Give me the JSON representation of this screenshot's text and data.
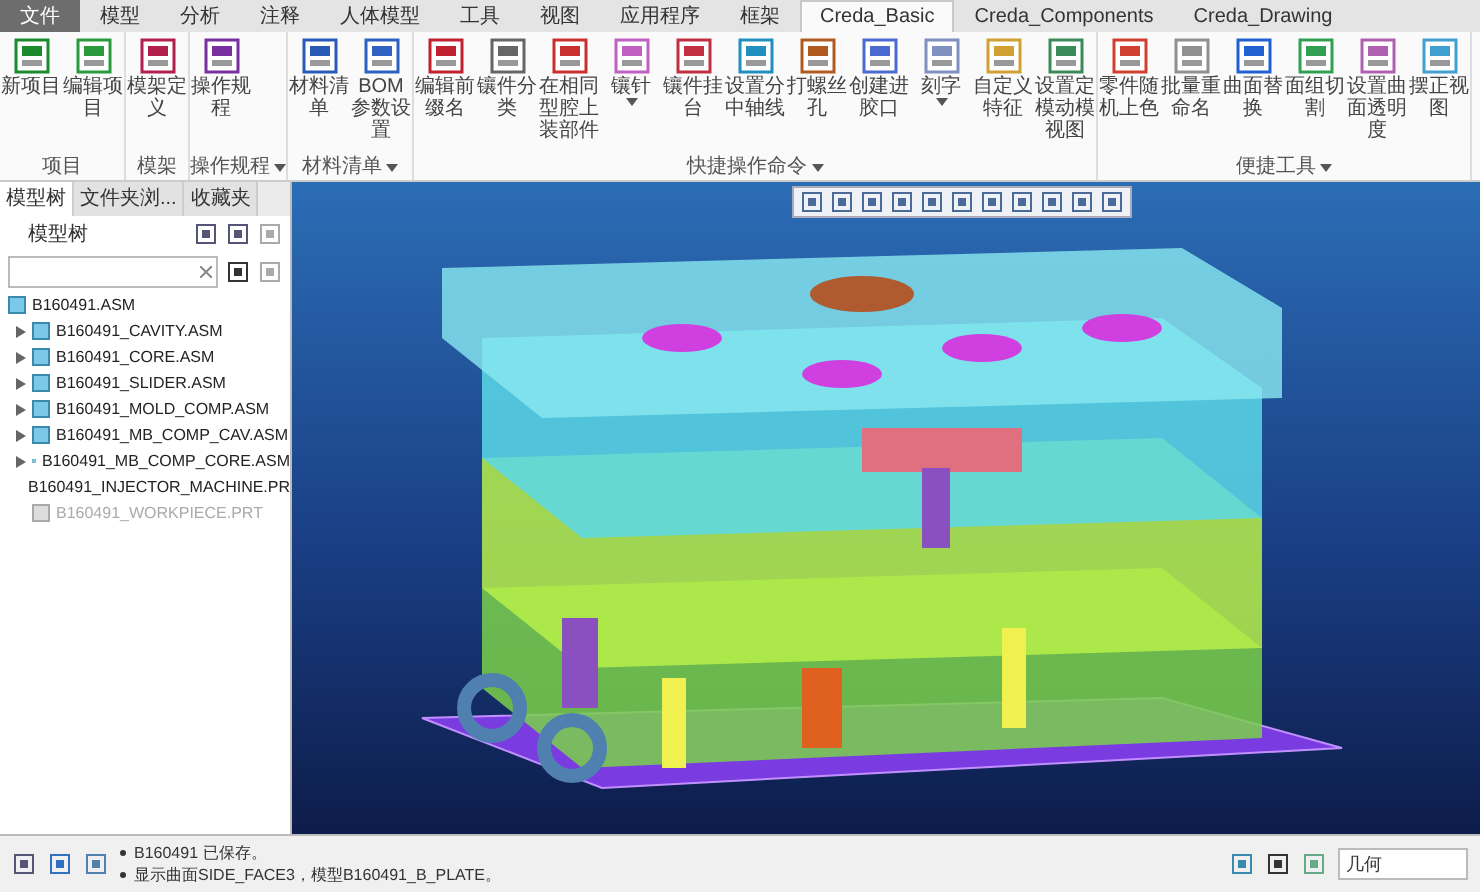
{
  "tabs": [
    {
      "label": "文件",
      "kind": "file",
      "selected": false
    },
    {
      "label": "模型",
      "kind": "tab",
      "selected": false
    },
    {
      "label": "分析",
      "kind": "tab",
      "selected": false
    },
    {
      "label": "注释",
      "kind": "tab",
      "selected": false
    },
    {
      "label": "人体模型",
      "kind": "tab",
      "selected": false
    },
    {
      "label": "工具",
      "kind": "tab",
      "selected": false
    },
    {
      "label": "视图",
      "kind": "tab",
      "selected": false
    },
    {
      "label": "应用程序",
      "kind": "tab",
      "selected": false
    },
    {
      "label": "框架",
      "kind": "tab",
      "selected": false
    },
    {
      "label": "Creda_Basic",
      "kind": "tab",
      "selected": true
    },
    {
      "label": "Creda_Components",
      "kind": "tab",
      "selected": false
    },
    {
      "label": "Creda_Drawing",
      "kind": "tab",
      "selected": false
    }
  ],
  "ribbon": [
    {
      "label": "项目",
      "has_menu": false,
      "tools": [
        {
          "label": "新项目",
          "has_menu": false
        },
        {
          "label": "编辑项目",
          "has_menu": false
        }
      ]
    },
    {
      "label": "模架",
      "has_menu": false,
      "tools": [
        {
          "label": "模架定义",
          "has_menu": false
        }
      ]
    },
    {
      "label": "操作规程",
      "has_menu": true,
      "tools": [
        {
          "label": "操作规程",
          "has_menu": false
        }
      ]
    },
    {
      "label": "材料清单",
      "has_menu": true,
      "tools": [
        {
          "label": "材料清单",
          "has_menu": false
        },
        {
          "label": "BOM参数设置",
          "has_menu": false
        }
      ]
    },
    {
      "label": "快捷操作命令",
      "has_menu": true,
      "tools": [
        {
          "label": "编辑前缀名",
          "has_menu": false
        },
        {
          "label": "镶件分类",
          "has_menu": false
        },
        {
          "label": "在相同型腔上装部件",
          "has_menu": false
        },
        {
          "label": "镶针",
          "has_menu": true
        },
        {
          "label": "镶件挂台",
          "has_menu": false
        },
        {
          "label": "设置分中轴线",
          "has_menu": false
        },
        {
          "label": "打螺丝孔",
          "has_menu": false
        },
        {
          "label": "创建进胶口",
          "has_menu": false
        },
        {
          "label": "刻字",
          "has_menu": true
        },
        {
          "label": "自定义特征",
          "has_menu": false
        },
        {
          "label": "设置定模动模视图",
          "has_menu": false
        }
      ]
    },
    {
      "label": "便捷工具",
      "has_menu": true,
      "tools": [
        {
          "label": "零件随机上色",
          "has_menu": false
        },
        {
          "label": "批量重命名",
          "has_menu": false
        },
        {
          "label": "曲面替换",
          "has_menu": false
        },
        {
          "label": "面组切割",
          "has_menu": false
        },
        {
          "label": "设置曲面透明度",
          "has_menu": false
        },
        {
          "label": "摆正视图",
          "has_menu": false
        }
      ]
    }
  ],
  "panel_tabs": [
    {
      "label": "模型树",
      "selected": true
    },
    {
      "label": "文件夹浏...",
      "selected": false
    },
    {
      "label": "收藏夹",
      "selected": false
    }
  ],
  "tree_title": "模型树",
  "tree": {
    "label": "B160491.ASM",
    "expanded": true,
    "children": [
      {
        "label": "B160491_CAVITY.ASM",
        "expandable": true,
        "disabled": false
      },
      {
        "label": "B160491_CORE.ASM",
        "expandable": true,
        "disabled": false
      },
      {
        "label": "B160491_SLIDER.ASM",
        "expandable": true,
        "disabled": false
      },
      {
        "label": "B160491_MOLD_COMP.ASM",
        "expandable": true,
        "disabled": false
      },
      {
        "label": "B160491_MB_COMP_CAV.ASM",
        "expandable": true,
        "disabled": false
      },
      {
        "label": "B160491_MB_COMP_CORE.ASM",
        "expandable": true,
        "disabled": false
      },
      {
        "label": "B160491_INJECTOR_MACHINE.PR",
        "expandable": false,
        "disabled": false
      },
      {
        "label": "B160491_WORKPIECE.PRT",
        "expandable": false,
        "disabled": true
      }
    ]
  },
  "messages": [
    "B160491 已保存。",
    "显示曲面SIDE_FACE3，模型B160491_B_PLATE。"
  ],
  "filter": {
    "value": "几何"
  }
}
